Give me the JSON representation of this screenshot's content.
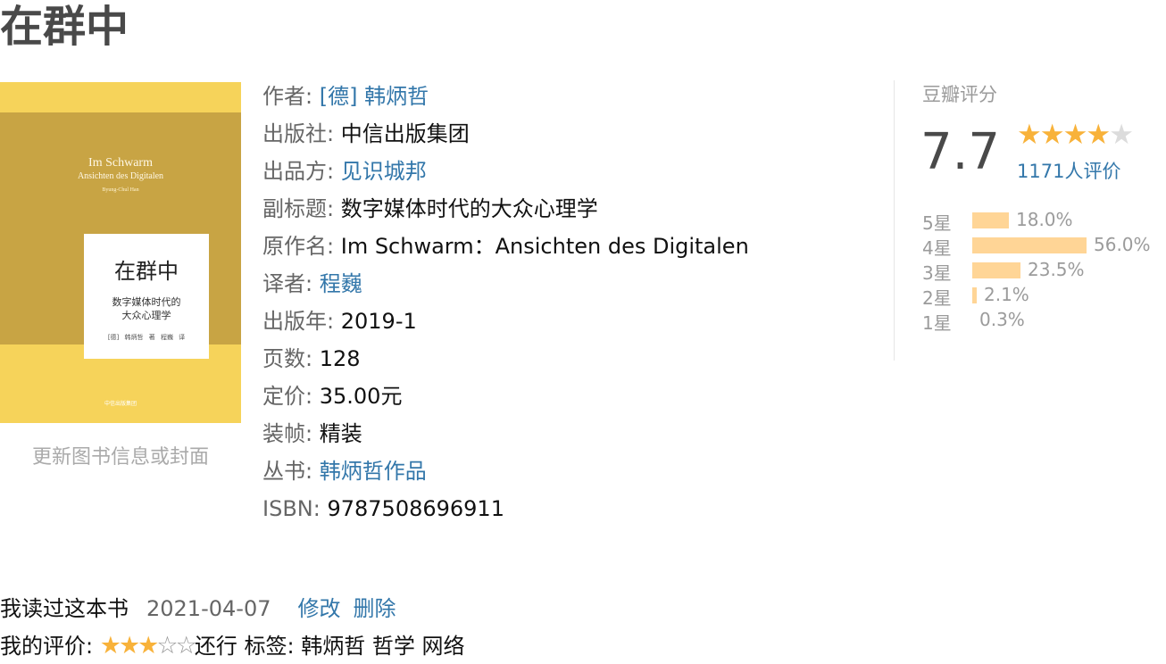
{
  "title": "在群中",
  "cover": {
    "en_title": "Im Schwarm",
    "en_subtitle": "Ansichten des Digitalen",
    "en_author": "Byung-Chul Han",
    "cn_title": "在群中",
    "cn_subtitle_line1": "数字媒体时代的",
    "cn_subtitle_line2": "大众心理学",
    "credit": "[德] 韩炳哲 著  程巍 译",
    "publisher": "中信出版集团"
  },
  "update_link": "更新图书信息或封面",
  "info": {
    "author_label": "作者:",
    "author": "[德] 韩炳哲",
    "publisher_label": "出版社:",
    "publisher": "中信出版集团",
    "producer_label": "出品方:",
    "producer": "见识城邦",
    "subtitle_label": "副标题:",
    "subtitle": "数字媒体时代的大众心理学",
    "original_title_label": "原作名:",
    "original_title": "Im Schwarm：Ansichten des Digitalen",
    "translator_label": "译者:",
    "translator": "程巍",
    "pub_year_label": "出版年:",
    "pub_year": "2019-1",
    "pages_label": "页数:",
    "pages": "128",
    "price_label": "定价:",
    "price": "35.00元",
    "binding_label": "装帧:",
    "binding": "精装",
    "series_label": "丛书:",
    "series": "韩炳哲作品",
    "isbn_label": "ISBN:",
    "isbn": "9787508696911"
  },
  "rating": {
    "title": "豆瓣评分",
    "score": "7.7",
    "stars_filled": 4,
    "stars_total": 5,
    "count_text": "1171人评价",
    "distribution": [
      {
        "label": "5星",
        "percent": 18.0,
        "percent_text": "18.0%"
      },
      {
        "label": "4星",
        "percent": 56.0,
        "percent_text": "56.0%"
      },
      {
        "label": "3星",
        "percent": 23.5,
        "percent_text": "23.5%"
      },
      {
        "label": "2星",
        "percent": 2.1,
        "percent_text": "2.1%"
      },
      {
        "label": "1星",
        "percent": 0.3,
        "percent_text": "0.3%"
      }
    ],
    "star_color": "#f8b23a",
    "bar_color": "#ffd596"
  },
  "my_reading": {
    "status": "我读过这本书",
    "date": "2021-04-07",
    "edit": "修改",
    "delete": "删除",
    "my_rating_label": "我的评价:",
    "my_stars": 3,
    "my_rating_text": "还行",
    "tags_label": "标签:",
    "tags": "韩炳哲 哲学 网络"
  },
  "link_color": "#3377aa"
}
